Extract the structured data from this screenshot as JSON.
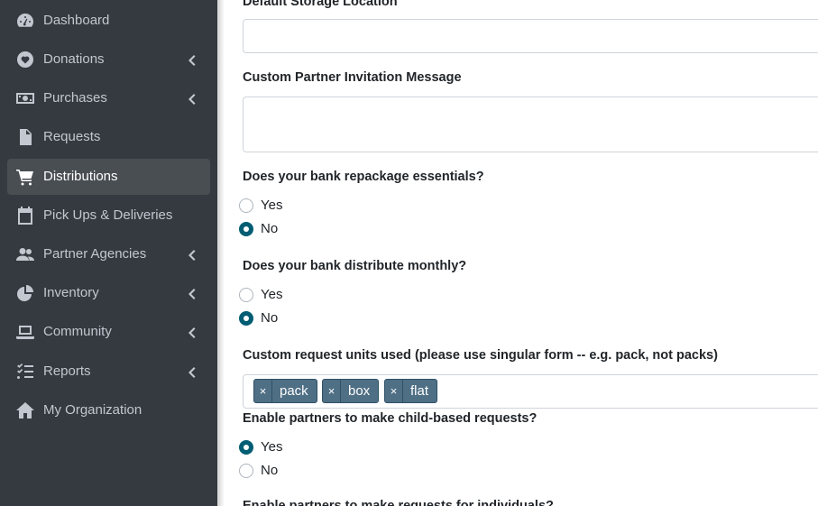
{
  "sidebar": {
    "items": [
      {
        "label": "Dashboard",
        "icon": "dashboard-icon",
        "has_submenu": false,
        "active": false
      },
      {
        "label": "Donations",
        "icon": "heart-icon",
        "has_submenu": true,
        "active": false
      },
      {
        "label": "Purchases",
        "icon": "money-bill-icon",
        "has_submenu": true,
        "active": false
      },
      {
        "label": "Requests",
        "icon": "file-icon",
        "has_submenu": false,
        "active": false
      },
      {
        "label": "Distributions",
        "icon": "shopping-cart-icon",
        "has_submenu": false,
        "active": true
      },
      {
        "label": "Pick Ups & Deliveries",
        "icon": "calendar-icon",
        "has_submenu": false,
        "active": false
      },
      {
        "label": "Partner Agencies",
        "icon": "users-icon",
        "has_submenu": true,
        "active": false
      },
      {
        "label": "Inventory",
        "icon": "pie-chart-icon",
        "has_submenu": true,
        "active": false
      },
      {
        "label": "Community",
        "icon": "laptop-icon",
        "has_submenu": true,
        "active": false
      },
      {
        "label": "Reports",
        "icon": "tasks-list-icon",
        "has_submenu": true,
        "active": false
      },
      {
        "label": "My Organization",
        "icon": "home-icon",
        "has_submenu": false,
        "active": false
      }
    ]
  },
  "form": {
    "default_storage": {
      "label": "Default Storage Location",
      "value": ""
    },
    "invitation_message": {
      "label": "Custom Partner Invitation Message",
      "value": ""
    },
    "repackage": {
      "label": "Does your bank repackage essentials?",
      "yes": "Yes",
      "no": "No",
      "selected": "No"
    },
    "distribute_monthly": {
      "label": "Does your bank distribute monthly?",
      "yes": "Yes",
      "no": "No",
      "selected": "No"
    },
    "request_units": {
      "label": "Custom request units used (please use singular form -- e.g. pack, not packs)",
      "tags": [
        "pack",
        "box",
        "flat"
      ],
      "remove_symbol": "×"
    },
    "child_requests": {
      "label": "Enable partners to make child-based requests?",
      "yes": "Yes",
      "no": "No",
      "selected": "Yes"
    },
    "individual_requests": {
      "label": "Enable partners to make requests for individuals?"
    }
  },
  "colors": {
    "sidebar_bg": "#343a40",
    "active_item_bg": "#494e53",
    "radio_checked": "#005d73",
    "tag_bg": "#4f6f85"
  }
}
